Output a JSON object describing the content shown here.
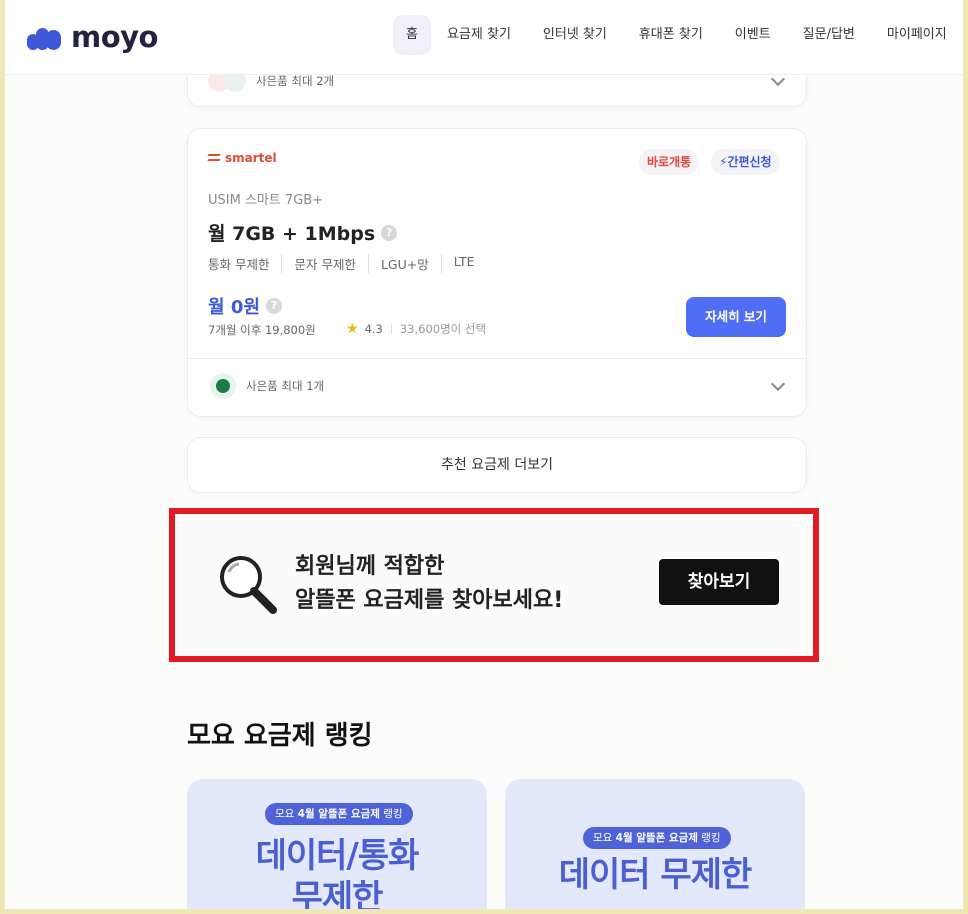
{
  "header": {
    "logo_text": "moyo",
    "nav": [
      "홈",
      "요금제 찾기",
      "인터넷 찾기",
      "휴대폰 찾기",
      "이벤트",
      "질문/답변",
      "마이페이지"
    ]
  },
  "top_card": {
    "gift_text": "사은품 최대 2개"
  },
  "plan_card": {
    "brand": "smartel",
    "badges": [
      "바로개통",
      "간편신청"
    ],
    "plan_name": "USIM 스마트 7GB+",
    "plan_title": "월 7GB + 1Mbps",
    "features": [
      "통화 무제한",
      "문자 무제한",
      "LGU+망",
      "LTE"
    ],
    "price": "월 0원",
    "after_price": "7개월 이후 19,800원",
    "rating": "4.3",
    "selected": "33,600명이 선택",
    "detail_label": "자세히 보기",
    "gift_text": "사은품 최대 1개"
  },
  "more_label": "추천 요금제 더보기",
  "banner": {
    "line1": "회원님께 적합한",
    "line2": "알뜰폰 요금제를 찾아보세요!",
    "button": "찾아보기"
  },
  "ranking": {
    "title": "모요 요금제 랭킹",
    "cards": [
      {
        "pill_prefix": "모요 ",
        "pill_bold": "4월 알뜰폰 요금제",
        "pill_suffix": " 랭킹",
        "line1": "데이터/통화",
        "line2": "무제한"
      },
      {
        "pill_prefix": "모요 ",
        "pill_bold": "4월 알뜰폰 요금제",
        "pill_suffix": " 랭킹",
        "line1": "데이터 무제한"
      }
    ]
  },
  "colors": {
    "brand_blue": "#3d58d8",
    "button_blue": "#4f6df5",
    "banner_border": "#e21b22",
    "background": "#f0e6b6"
  }
}
